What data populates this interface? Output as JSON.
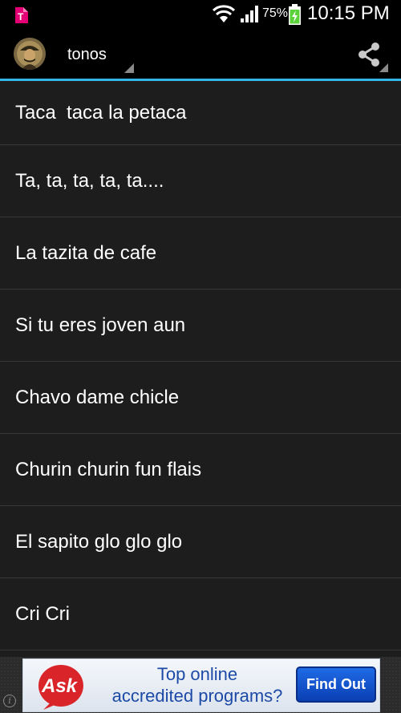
{
  "status_bar": {
    "carrier_icon": "t-mobile-icon",
    "wifi_icon": "wifi-icon",
    "signal_icon": "signal-bars-icon",
    "battery_percent": "75%",
    "battery_icon": "battery-charging-icon",
    "time": "10:15 PM"
  },
  "action_bar": {
    "title": "tonos",
    "share_icon": "share-icon"
  },
  "list": {
    "items": [
      {
        "label": "Taca  taca la petaca"
      },
      {
        "label": "Ta, ta, ta, ta, ta...."
      },
      {
        "label": "La tazita de cafe"
      },
      {
        "label": "Si tu eres joven aun"
      },
      {
        "label": "Chavo dame chicle"
      },
      {
        "label": "Churin churin fun flais"
      },
      {
        "label": "El sapito glo glo glo"
      },
      {
        "label": "Cri Cri"
      }
    ]
  },
  "ad": {
    "info_icon": "info-icon",
    "logo_text": "Ask",
    "line1": "Top online",
    "line2": "accredited programs?",
    "cta": "Find Out"
  },
  "colors": {
    "accent": "#33b5e5",
    "background": "#1d1d1d",
    "status_bar": "#000000",
    "battery_green": "#5bd13a",
    "ask_red": "#d9252a",
    "ad_blue": "#1c4aa6"
  }
}
